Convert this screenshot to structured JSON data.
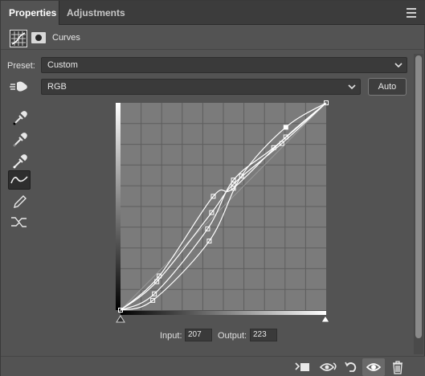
{
  "tabs": [
    {
      "label": "Properties",
      "active": true
    },
    {
      "label": "Adjustments",
      "active": false
    }
  ],
  "header": {
    "adjustment_name": "Curves"
  },
  "preset": {
    "label": "Preset:",
    "value": "Custom"
  },
  "channel": {
    "value": "RGB"
  },
  "auto_button": {
    "label": "Auto"
  },
  "tools": [
    "eyedropper-black-icon",
    "eyedropper-gray-icon",
    "eyedropper-white-icon",
    "curve-points-icon",
    "pencil-icon",
    "smooth-icon"
  ],
  "io": {
    "input_label": "Input:",
    "input_value": "207",
    "output_label": "Output:",
    "output_value": "223"
  },
  "bottom_buttons": [
    "clip-to-layer-icon",
    "view-previous-state-icon",
    "reset-icon",
    "visibility-eye-icon",
    "trash-icon"
  ],
  "colors": {
    "panel_bg": "#535353",
    "graph_bg": "#7b7b7b",
    "grid": "#5e5e5e",
    "curve": "#ffffff"
  },
  "curves": [
    [
      [
        0,
        0
      ],
      [
        48,
        42
      ],
      [
        115,
        140
      ],
      [
        140,
        150
      ],
      [
        205,
        213
      ],
      [
        255,
        255
      ]
    ],
    [
      [
        0,
        0
      ],
      [
        45,
        35
      ],
      [
        113,
        120
      ],
      [
        140,
        155
      ],
      [
        200,
        205
      ],
      [
        255,
        255
      ]
    ],
    [
      [
        0,
        0
      ],
      [
        42,
        20
      ],
      [
        108,
        100
      ],
      [
        140,
        160
      ],
      [
        190,
        200
      ],
      [
        255,
        255
      ]
    ],
    [
      [
        0,
        0
      ],
      [
        40,
        12
      ],
      [
        110,
        85
      ],
      [
        150,
        165
      ],
      [
        205,
        225
      ],
      [
        255,
        255
      ]
    ]
  ]
}
